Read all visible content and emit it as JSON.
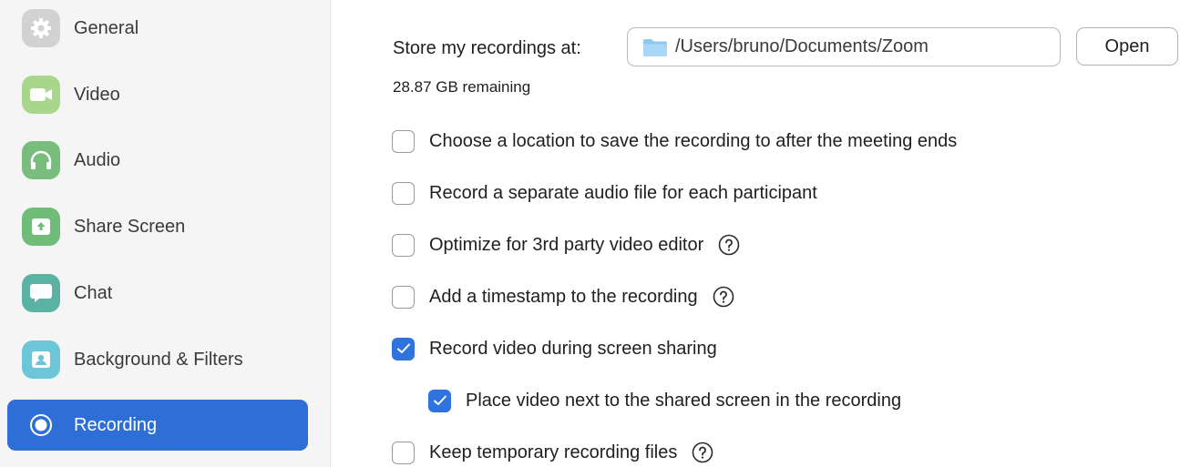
{
  "sidebar": {
    "items": [
      {
        "label": "General",
        "icon": "gear-icon",
        "color": "#d2d2d2"
      },
      {
        "label": "Video",
        "icon": "video-camera-icon",
        "color": "#a7d68d"
      },
      {
        "label": "Audio",
        "icon": "headphones-icon",
        "color": "#79bd7c"
      },
      {
        "label": "Share Screen",
        "icon": "share-screen-icon",
        "color": "#6fbd78"
      },
      {
        "label": "Chat",
        "icon": "chat-bubble-icon",
        "color": "#5ab2a3"
      },
      {
        "label": "Background & Filters",
        "icon": "portrait-icon",
        "color": "#6cc6d8"
      },
      {
        "label": "Recording",
        "icon": "record-icon",
        "color": "#2d6fd6",
        "active": true
      }
    ]
  },
  "recording": {
    "store_label": "Store my recordings at:",
    "path": "/Users/bruno/Documents/Zoom",
    "open_label": "Open",
    "remaining": "28.87 GB remaining",
    "options": [
      {
        "label": "Choose a location to save the recording to after the meeting ends",
        "checked": false,
        "help": false
      },
      {
        "label": "Record a separate audio file for each participant",
        "checked": false,
        "help": false
      },
      {
        "label": "Optimize for 3rd party video editor",
        "checked": false,
        "help": true
      },
      {
        "label": "Add a timestamp to the recording",
        "checked": false,
        "help": true
      },
      {
        "label": "Record video during screen sharing",
        "checked": true,
        "help": false
      },
      {
        "label": "Place video next to the shared screen in the recording",
        "checked": true,
        "help": false
      },
      {
        "label": "Keep temporary recording files",
        "checked": false,
        "help": true
      }
    ]
  },
  "colors": {
    "accent": "#2d6fd6",
    "checkbox_checked": "#2f73de",
    "folder": "#8ec8f2"
  }
}
